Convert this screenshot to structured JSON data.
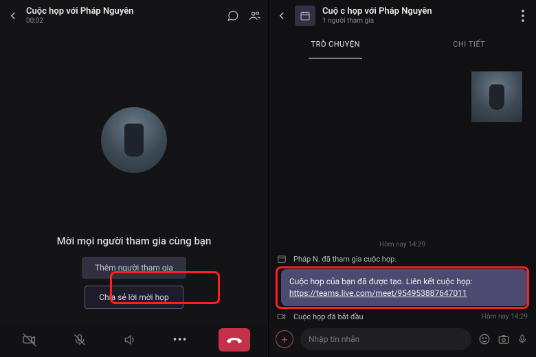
{
  "left": {
    "header": {
      "title": "Cuộc họp với Pháp Nguyên",
      "timer": "00:02"
    },
    "prompt": "Mời mọi người tham gia cùng bạn",
    "buttons": {
      "add_people": "Thêm người tham gia",
      "share_invite": "Chia sẻ lời mời họp"
    }
  },
  "right": {
    "header": {
      "title": "Cuộ c họp với Pháp Nguyên",
      "subtitle": "1 người tham gia"
    },
    "tabs": {
      "chat": "TRÒ CHUYỆN",
      "details": "CHI TIẾT"
    },
    "messages": {
      "day_divider": "Hôm nay 14:29",
      "join_event": "Pháp N. đã tham gia cuộc họp.",
      "meeting_created": "Cuộc họp của bạn đã được tạo. Liên kết cuộc họp: ",
      "meeting_link": "https://teams.live.com/meet/954953887647011",
      "started": "Cuộc họp đã bắt đầu",
      "started_ts": "Hôm nay 14:29"
    },
    "compose": {
      "placeholder": "Nhập tin nhắn"
    }
  }
}
